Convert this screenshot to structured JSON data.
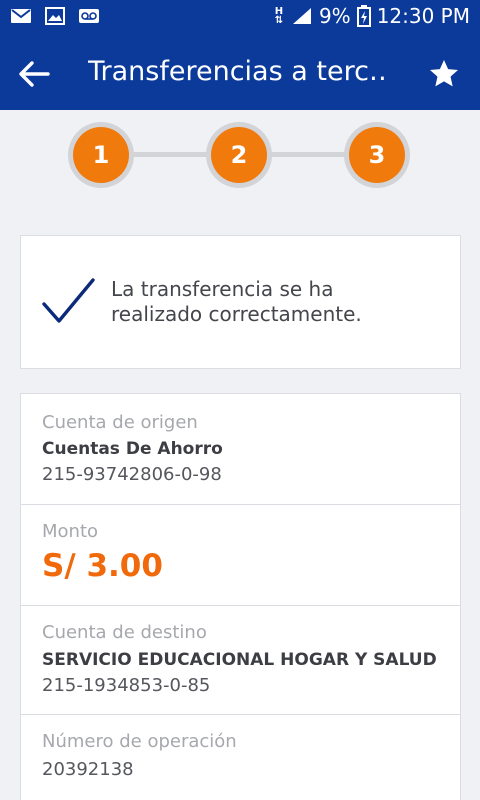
{
  "status_bar": {
    "battery": "9%",
    "time": "12:30 PM",
    "network": "H",
    "icons": [
      "mail-icon",
      "image-icon",
      "voicemail-icon",
      "signal-icon",
      "battery-icon"
    ]
  },
  "app_bar": {
    "title": "Transferencias a terc…",
    "back_icon": "arrow-left-icon",
    "favorite_icon": "star-icon"
  },
  "stepper": {
    "steps": [
      "1",
      "2",
      "3"
    ],
    "accent": "#f07a0c"
  },
  "success": {
    "line1": "La transferencia se ha",
    "line2": "realizado correctamente.",
    "icon": "checkmark-icon"
  },
  "details": {
    "origin": {
      "label": "Cuenta de origen",
      "type": "Cuentas De Ahorro",
      "number": "215-93742806-0-98"
    },
    "amount": {
      "label": "Monto",
      "value": "S/ 3.00"
    },
    "destination": {
      "label": "Cuenta de destino",
      "name": "SERVICIO EDUCACIONAL HOGAR Y SALUD",
      "number": "215-1934853-0-85"
    },
    "operation": {
      "label": "Número de operación",
      "value": "20392138"
    }
  },
  "colors": {
    "primary": "#0b3a9b",
    "accent": "#f07a0c",
    "amount": "#f06a0c"
  }
}
